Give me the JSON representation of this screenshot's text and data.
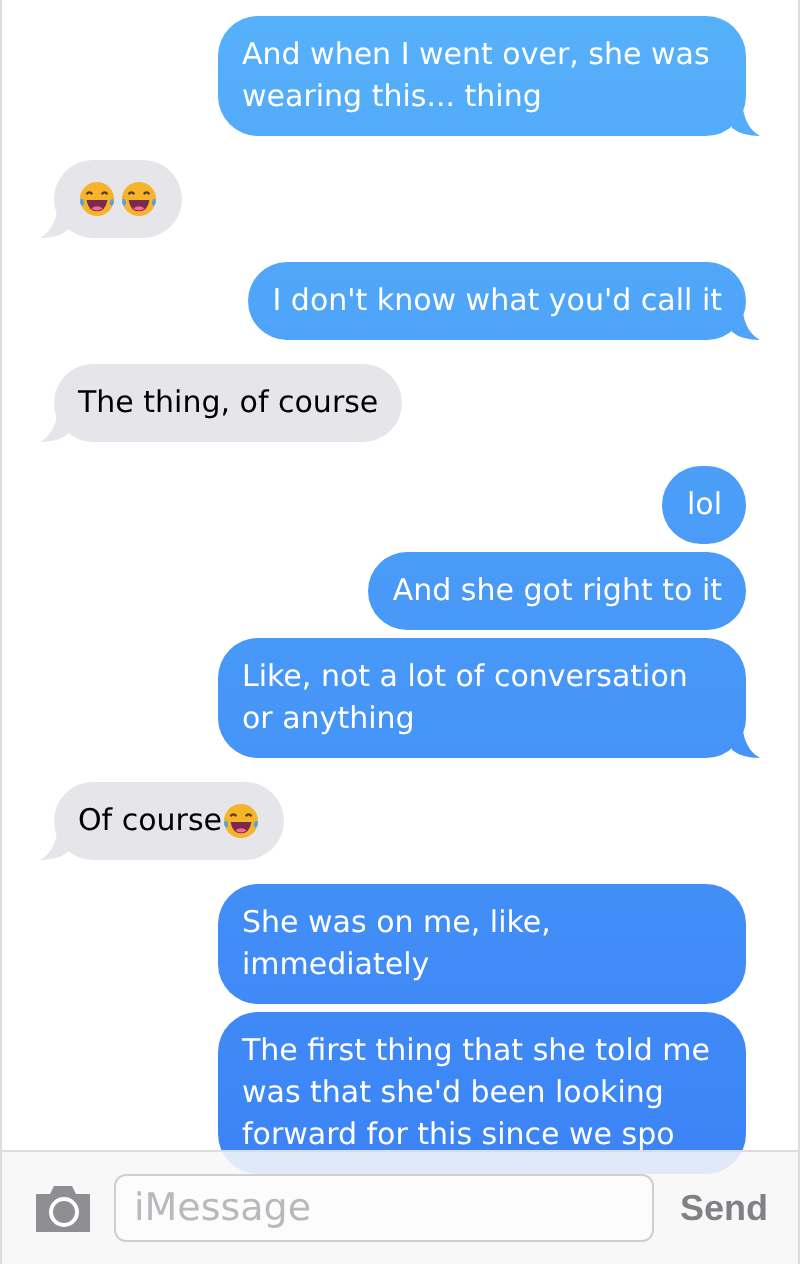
{
  "messages": [
    {
      "kind": "sent",
      "text": "And when I went over, she was wearing this... thing",
      "tail": true
    },
    {
      "kind": "received",
      "emojis": [
        {
          "kind": "laughing"
        },
        {
          "kind": "laughing"
        }
      ],
      "tail": true
    },
    {
      "kind": "sent",
      "text": "I don't know what you'd call it",
      "tail": true
    },
    {
      "kind": "received",
      "text": "The thing, of course",
      "tail": true
    },
    {
      "kind": "sent",
      "text": "lol",
      "tail": false
    },
    {
      "kind": "sent",
      "text": "And she got right to it",
      "tail": false
    },
    {
      "kind": "sent",
      "text": "Like, not a lot of conversation or anything",
      "tail": true
    },
    {
      "kind": "received",
      "text": "Of course",
      "emojis": [
        {
          "kind": "laughing"
        }
      ],
      "tail": true
    },
    {
      "kind": "sent",
      "text": "She was on me, like, immediately",
      "tail": false
    },
    {
      "kind": "sent",
      "text": "The first thing that she told me was that she'd been looking forward for this since we spo",
      "tail": false
    }
  ],
  "compose": {
    "placeholder": "iMessage",
    "send": "Send"
  }
}
